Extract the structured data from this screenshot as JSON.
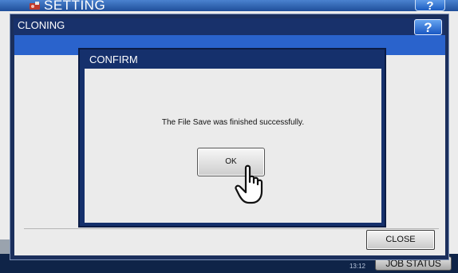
{
  "background": {
    "title": "SETTING",
    "help_label": "?",
    "clock_time": "13:12",
    "job_status_label": "JOB STATUS"
  },
  "cloning_dialog": {
    "title": "CLONING",
    "help_label": "?",
    "close_label": "CLOSE"
  },
  "confirm_dialog": {
    "title": "CONFIRM",
    "message": "The File Save was finished successfully.",
    "ok_label": "OK"
  },
  "icons": [
    "setting-icon",
    "pointer-hand-icon"
  ],
  "colors": {
    "title_bar": "#18316b",
    "band": "#2a63cc",
    "dialog_body": "#ebebeb",
    "help_button": "#1957c2"
  }
}
